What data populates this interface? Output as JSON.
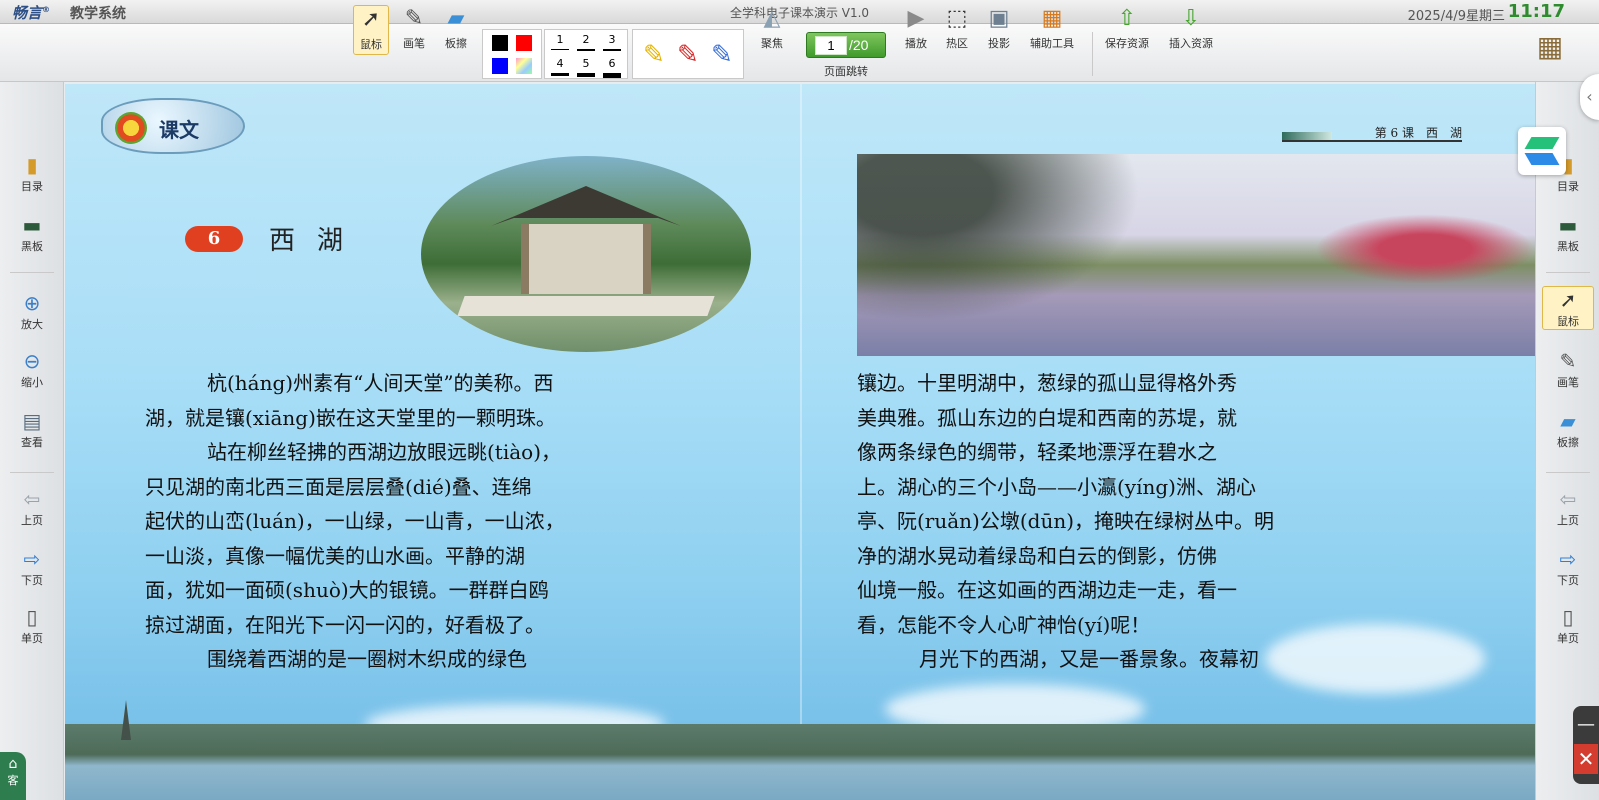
{
  "titlebar": {
    "logo": "畅言",
    "logo_mark": "®",
    "app_name": "教学系统",
    "window_title": "全学科电子课本演示 V1.0",
    "date": "2025/4/9星期三",
    "time": "11:17"
  },
  "toolbar": {
    "mouse": "鼠标",
    "pen": "画笔",
    "eraser": "板擦",
    "width_numbers": [
      "1",
      "2",
      "3",
      "4",
      "5",
      "6"
    ],
    "focus": "聚焦",
    "page_current": "1",
    "page_total": "/20",
    "page_jump": "页面跳转",
    "play": "播放",
    "hotspot": "热区",
    "projector": "投影",
    "assist_tools": "辅助工具",
    "save_resource": "保存资源",
    "insert_resource": "插入资源"
  },
  "colors": {
    "swatches": [
      "#000000",
      "#ff0000",
      "#0000ff",
      "rainbow"
    ],
    "accent_green": "#3f9a2c",
    "active_highlight": "#fff3c6",
    "lesson_badge": "#e0401f"
  },
  "left_panel": {
    "items": [
      "目录",
      "黑板",
      "放大",
      "缩小",
      "查看",
      "上页",
      "下页",
      "单页"
    ],
    "corner_tab": "客"
  },
  "right_panel": {
    "items": [
      "目录",
      "黑板",
      "鼠标",
      "画笔",
      "板擦",
      "上页",
      "下页",
      "单页"
    ]
  },
  "book": {
    "section_badge": "课文",
    "lesson_number": "6",
    "lesson_title": "西湖",
    "running_header": "第 6 课　西　湖",
    "left_lines": [
      "杭(háng)州素有“人间天堂”的美称。西",
      "湖，就是镶(xiāng)嵌在这天堂里的一颗明珠。",
      "站在柳丝轻拂的西湖边放眼远眺(tiào)，",
      "只见湖的南北西三面是层层叠(dié)叠、连绵",
      "起伏的山峦(luán)，一山绿，一山青，一山浓，",
      "一山淡，真像一幅优美的山水画。平静的湖",
      "面，犹如一面硕(shuò)大的银镜。一群群白鸥",
      "掠过湖面，在阳光下一闪一闪的，好看极了。",
      "围绕着西湖的是一圈树木织成的绿色"
    ],
    "right_lines": [
      "镶边。十里明湖中，葱绿的孤山显得格外秀",
      "美典雅。孤山东边的白堤和西南的苏堤，就",
      "像两条绿色的绸带，轻柔地漂浮在碧水之",
      "上。湖心的三个小岛——小瀛(yíng)洲、湖心",
      "亭、阮(ruǎn)公墩(dūn)，掩映在绿树丛中。明",
      "净的湖水晃动着绿岛和白云的倒影，仿佛",
      "仙境一般。在这如画的西湖边走一走，看一",
      "看，怎能不令人心旷神怡(yí)呢！",
      "月光下的西湖，又是一番景象。夜幕初"
    ]
  }
}
